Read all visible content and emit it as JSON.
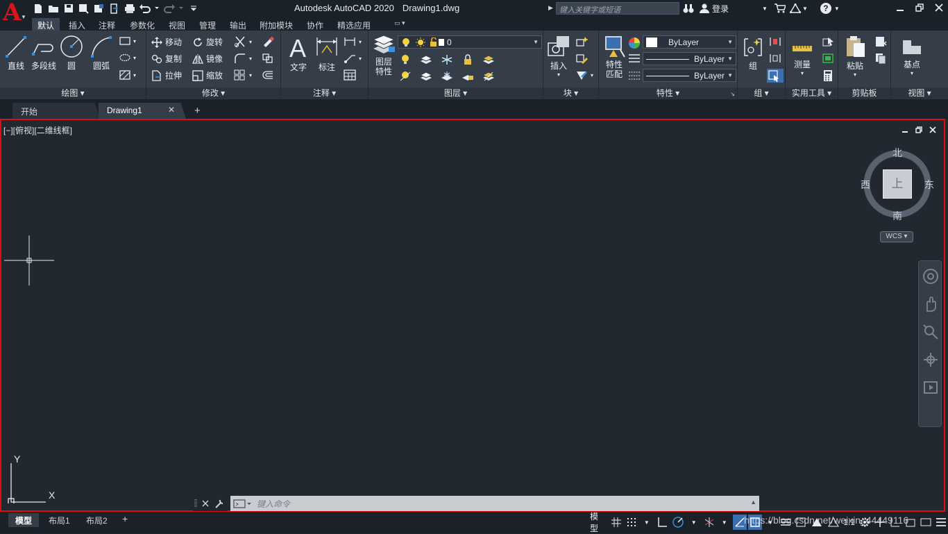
{
  "app": {
    "name": "Autodesk AutoCAD 2020",
    "file": "Drawing1.dwg",
    "logo_letter": "A"
  },
  "search": {
    "placeholder": "键入关键字或短语"
  },
  "account": {
    "login_label": "登录",
    "help_label": "?"
  },
  "ribbon_tabs": [
    "默认",
    "插入",
    "注释",
    "参数化",
    "视图",
    "管理",
    "输出",
    "附加模块",
    "协作",
    "精选应用"
  ],
  "panels": {
    "draw": {
      "title": "绘图 ▾",
      "tools": [
        "直线",
        "多段线",
        "圆",
        "圆弧"
      ]
    },
    "modify": {
      "title": "修改 ▾",
      "rows": [
        "移动",
        "旋转",
        "复制",
        "镜像",
        "拉伸",
        "缩放"
      ]
    },
    "annotation": {
      "title": "注释 ▾",
      "tools": [
        "文字",
        "标注"
      ]
    },
    "layers": {
      "title": "图层 ▾",
      "tool": "图层\n特性",
      "current_layer": "0"
    },
    "block": {
      "title": "块 ▾",
      "tool": "插入"
    },
    "properties": {
      "title": "特性 ▾",
      "tool": "特性\n匹配",
      "color": "ByLayer",
      "linetype": "ByLayer",
      "lineweight": "ByLayer"
    },
    "groups": {
      "title": "组 ▾",
      "tool": "组"
    },
    "utilities": {
      "title": "实用工具 ▾",
      "tool": "测量"
    },
    "clipboard": {
      "title": "剪贴板",
      "tool": "粘贴"
    },
    "view": {
      "title": "视图 ▾",
      "tool": "基点"
    }
  },
  "doc_tabs": {
    "start": "开始",
    "drawing": "Drawing1",
    "close": "✕",
    "new": "+"
  },
  "viewport": {
    "label": "[−][俯视][二维线框]",
    "viewcube": {
      "north": "北",
      "south": "南",
      "east": "东",
      "west": "西",
      "face": "上"
    },
    "wcs": "WCS ▾",
    "ucs": {
      "y": "Y",
      "x": "X"
    }
  },
  "command": {
    "placeholder": "键入命令"
  },
  "layout_tabs": [
    "模型",
    "布局1",
    "布局2"
  ],
  "layout_add": "+",
  "status": {
    "model_label": "模型",
    "scale_label": "1:1",
    "watermark": "https://blog.csdn.net/weixin_44449116"
  },
  "colors": {
    "accent": "#3b6fb0",
    "viewport_border": "#e00d0d",
    "background": "#212830"
  }
}
